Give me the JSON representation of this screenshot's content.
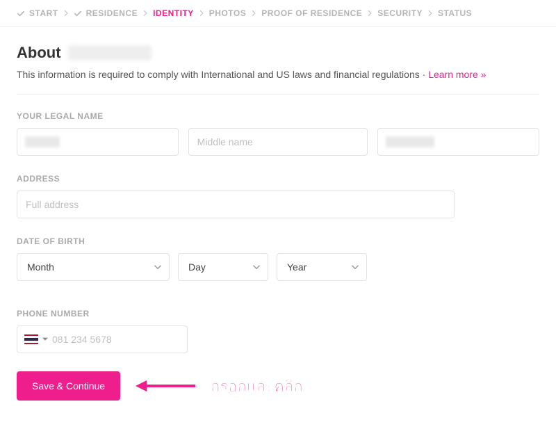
{
  "breadcrumb": [
    {
      "label": "START",
      "completed": true,
      "active": false
    },
    {
      "label": "RESIDENCE",
      "completed": true,
      "active": false
    },
    {
      "label": "IDENTITY",
      "completed": false,
      "active": true
    },
    {
      "label": "PHOTOS",
      "completed": false,
      "active": false
    },
    {
      "label": "PROOF OF RESIDENCE",
      "completed": false,
      "active": false
    },
    {
      "label": "SECURITY",
      "completed": false,
      "active": false
    },
    {
      "label": "STATUS",
      "completed": false,
      "active": false
    }
  ],
  "heading": "About",
  "subtext": "This information is required to comply with International and US laws and financial regulations · ",
  "learn_more": "Learn more »",
  "sections": {
    "legal_name": {
      "label": "YOUR LEGAL NAME",
      "first_placeholder": "",
      "middle_placeholder": "Middle name",
      "last_placeholder": ""
    },
    "address": {
      "label": "ADDRESS",
      "placeholder": "Full address"
    },
    "dob": {
      "label": "DATE OF BIRTH",
      "month": "Month",
      "day": "Day",
      "year": "Year"
    },
    "phone": {
      "label": "PHONE NUMBER",
      "placeholder": "081 234 5678",
      "country_code": "TH"
    }
  },
  "save_button": "Save & Continue",
  "annotation": "กรอกและคลิก",
  "colors": {
    "accent": "#ee1e8c"
  }
}
